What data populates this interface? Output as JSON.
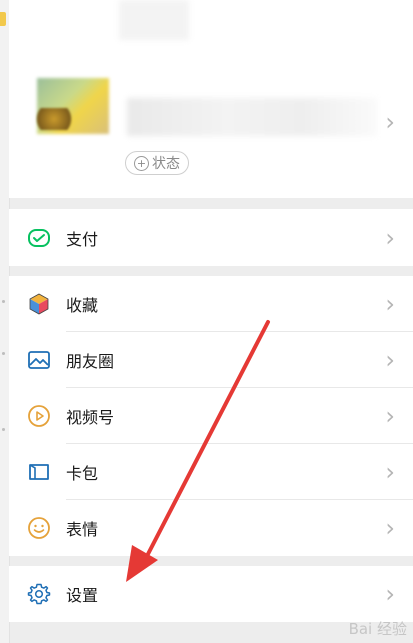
{
  "profile": {
    "status_label": "状态",
    "status_plus": "+"
  },
  "menu": {
    "pay": "支付",
    "favorites": "收藏",
    "moments": "朋友圈",
    "channels": "视频号",
    "cards": "卡包",
    "stickers": "表情",
    "settings": "设置"
  },
  "chevron": "›",
  "watermark": "Bai 经验",
  "colors": {
    "pay_green": "#07c160",
    "arrow_red": "#e53935",
    "icon_blue": "#1f6fb5",
    "icon_orange": "#e5a23a"
  }
}
